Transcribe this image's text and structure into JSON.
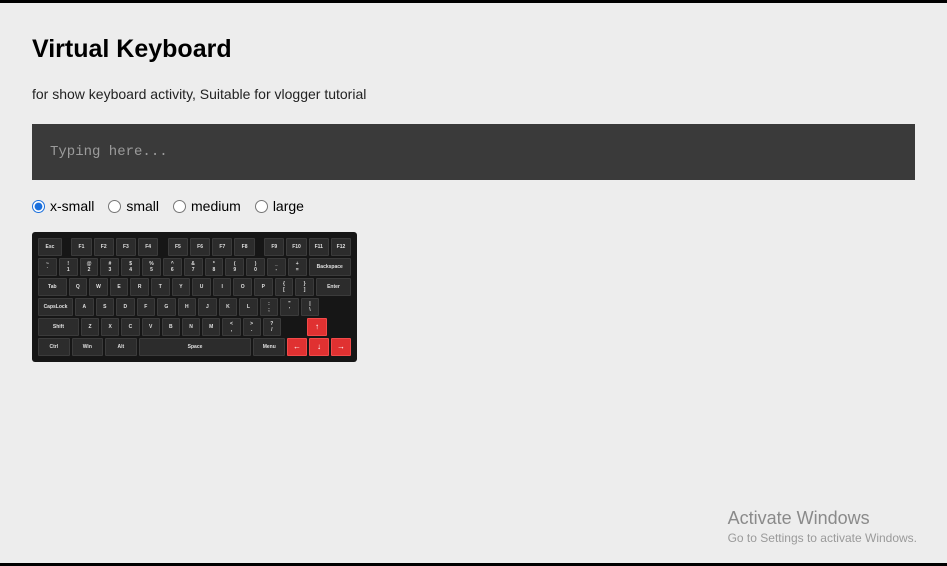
{
  "page": {
    "title": "Virtual Keyboard",
    "subtitle": "for show keyboard activity, Suitable for vlogger tutorial"
  },
  "input": {
    "placeholder": "Typing here...",
    "value": ""
  },
  "sizes": {
    "options": [
      "x-small",
      "small",
      "medium",
      "large"
    ],
    "selected": "x-small"
  },
  "keyboard": {
    "row_fn": [
      "Esc",
      "F1",
      "F2",
      "F3",
      "F4",
      "F5",
      "F6",
      "F7",
      "F8",
      "F9",
      "F10",
      "F11",
      "F12"
    ],
    "row_num": [
      {
        "top": "~",
        "bot": "`"
      },
      {
        "top": "!",
        "bot": "1"
      },
      {
        "top": "@",
        "bot": "2"
      },
      {
        "top": "#",
        "bot": "3"
      },
      {
        "top": "$",
        "bot": "4"
      },
      {
        "top": "%",
        "bot": "5"
      },
      {
        "top": "^",
        "bot": "6"
      },
      {
        "top": "&",
        "bot": "7"
      },
      {
        "top": "*",
        "bot": "8"
      },
      {
        "top": "(",
        "bot": "9"
      },
      {
        "top": ")",
        "bot": "0"
      },
      {
        "top": "_",
        "bot": "-"
      },
      {
        "top": "+",
        "bot": "="
      }
    ],
    "backspace": "Backspace",
    "tab": "Tab",
    "row_q": [
      "Q",
      "W",
      "E",
      "R",
      "T",
      "Y",
      "U",
      "I",
      "O",
      "P"
    ],
    "row_q_tail": [
      {
        "top": "{",
        "bot": "["
      },
      {
        "top": "}",
        "bot": "]"
      }
    ],
    "enter": "Enter",
    "caps": "CapsLock",
    "row_a": [
      "A",
      "S",
      "D",
      "F",
      "G",
      "H",
      "J",
      "K",
      "L"
    ],
    "row_a_tail": [
      {
        "top": ":",
        "bot": ";"
      },
      {
        "top": "\"",
        "bot": "'"
      },
      {
        "top": "|",
        "bot": "\\"
      }
    ],
    "shift": "Shift",
    "row_z": [
      "Z",
      "X",
      "C",
      "V",
      "B",
      "N",
      "M"
    ],
    "row_z_tail": [
      {
        "top": "<",
        "bot": ","
      },
      {
        "top": ">",
        "bot": "."
      },
      {
        "top": "?",
        "bot": "/"
      }
    ],
    "bottom": {
      "ctrl": "Ctrl",
      "win": "Win",
      "alt": "Alt",
      "space": "Space",
      "menu": "Menu"
    },
    "arrows": {
      "up": "↑",
      "left": "←",
      "down": "↓",
      "right": "→"
    }
  },
  "watermark": {
    "line1": "Activate Windows",
    "line2": "Go to Settings to activate Windows."
  }
}
